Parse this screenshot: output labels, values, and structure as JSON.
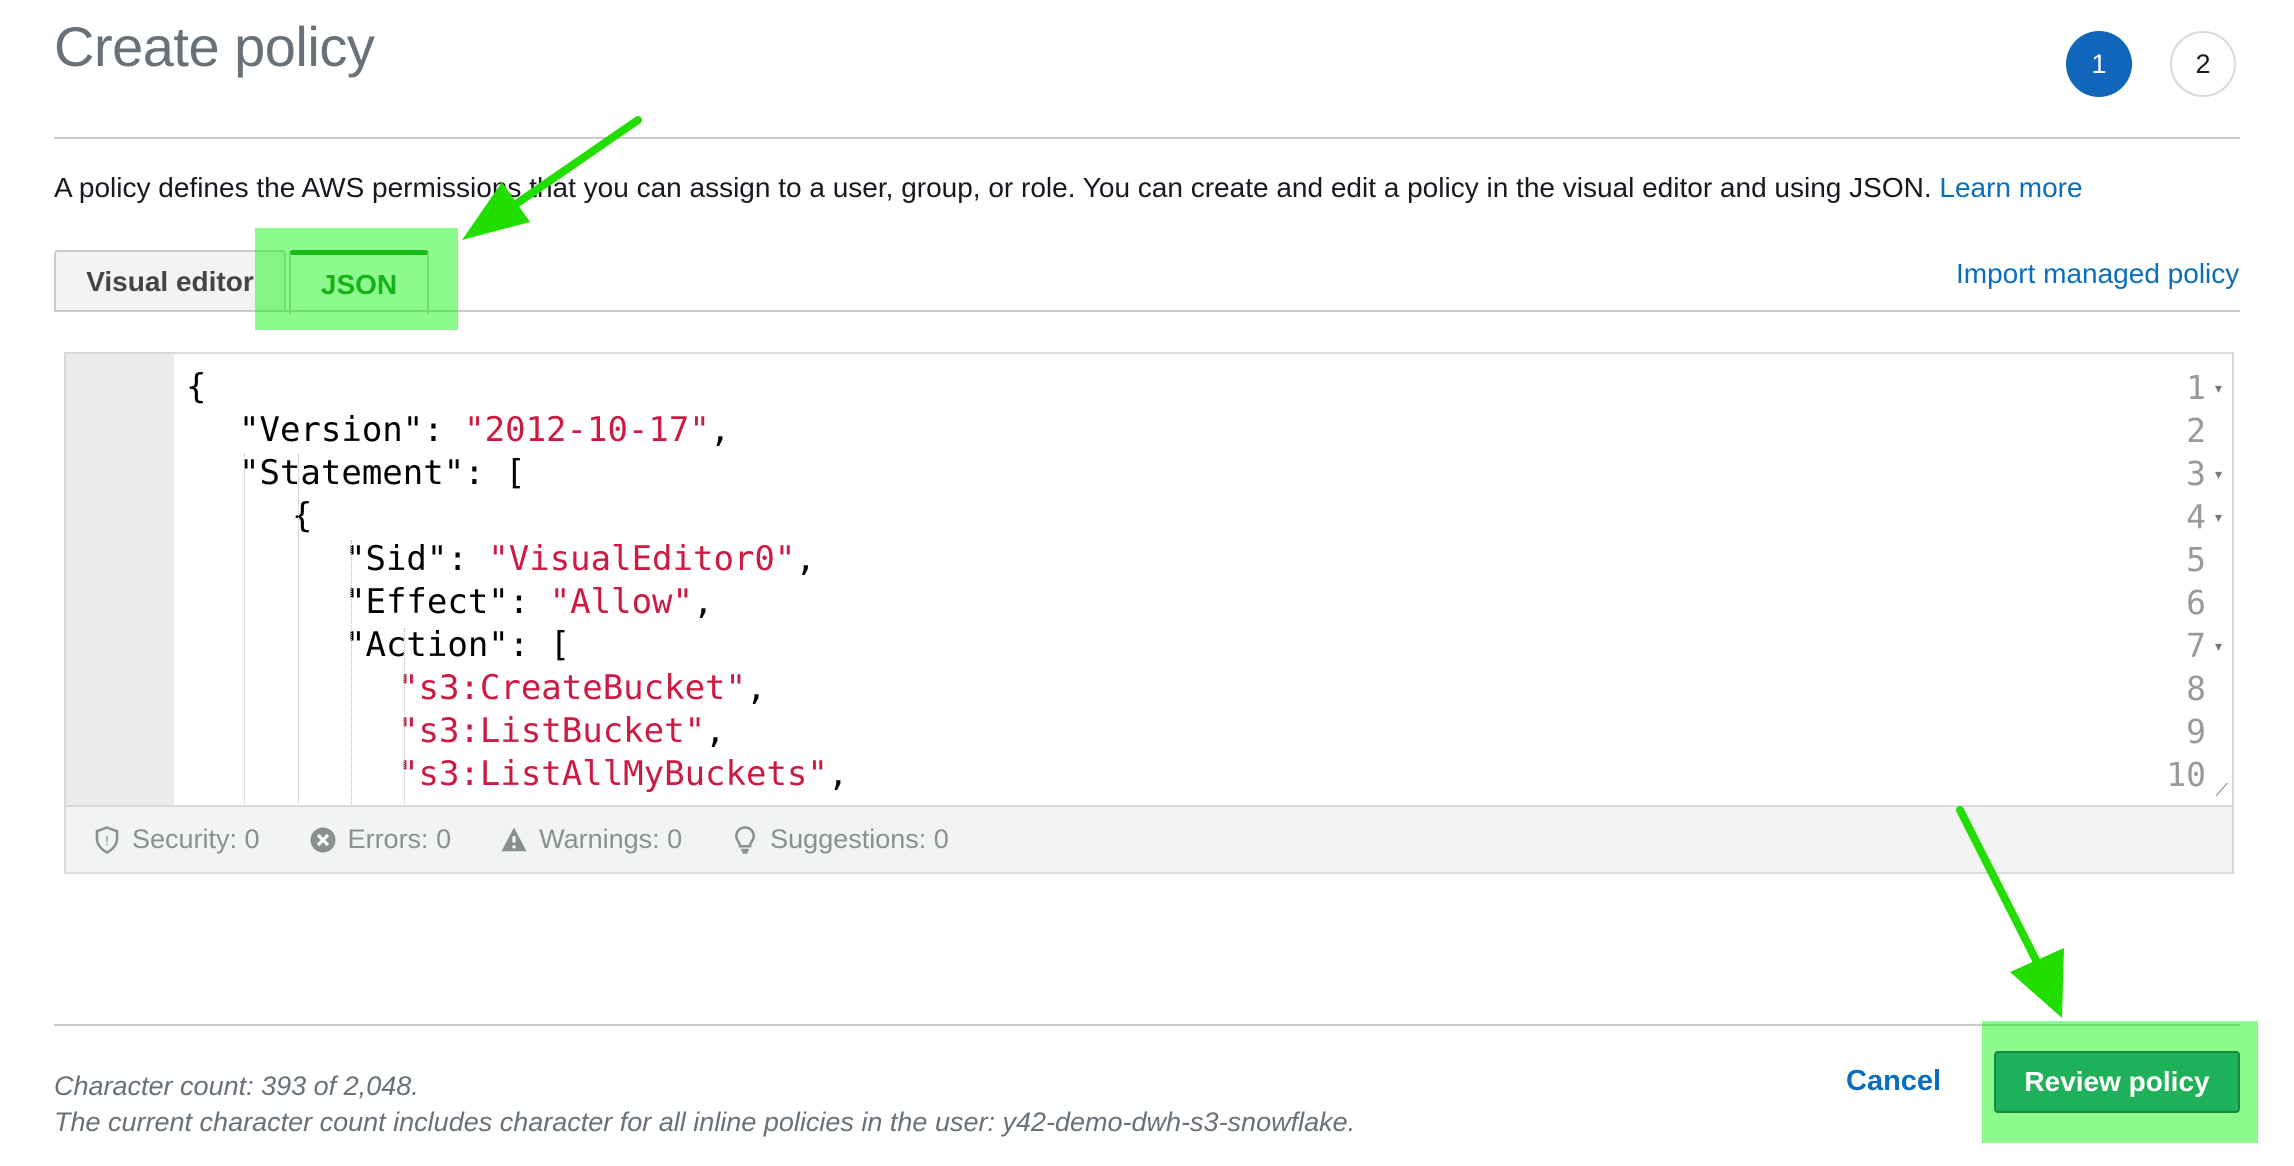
{
  "page": {
    "title": "Create policy",
    "steps": [
      "1",
      "2"
    ],
    "active_step": "1",
    "description": "A policy defines the AWS permissions that you can assign to a user, group, or role. You can create and edit a policy in the visual editor and using JSON.",
    "learn_more": "Learn more"
  },
  "tabs": {
    "visual_editor": "Visual editor",
    "json": "JSON",
    "active": "JSON",
    "import_link": "Import managed policy"
  },
  "editor": {
    "lines": [
      {
        "num": "1",
        "text": "{"
      },
      {
        "num": "2",
        "key": "\"Version\": ",
        "str": "\"2012-10-17\"",
        "tail": ","
      },
      {
        "num": "3",
        "text": "\"Statement\": ["
      },
      {
        "num": "4",
        "text": "{"
      },
      {
        "num": "5",
        "key": "\"Sid\": ",
        "str": "\"VisualEditor0\"",
        "tail": ","
      },
      {
        "num": "6",
        "key": "\"Effect\": ",
        "str": "\"Allow\"",
        "tail": ","
      },
      {
        "num": "7",
        "text": "\"Action\": ["
      },
      {
        "num": "8",
        "str": "\"s3:CreateBucket\"",
        "tail": ","
      },
      {
        "num": "9",
        "str": "\"s3:ListBucket\"",
        "tail": ","
      },
      {
        "num": "10",
        "str": "\"s3:ListAllMyBuckets\"",
        "tail": ","
      }
    ]
  },
  "status": {
    "security": "Security: 0",
    "errors": "Errors: 0",
    "warnings": "Warnings: 0",
    "suggestions": "Suggestions: 0"
  },
  "footer": {
    "char_count": "Character count: 393 of 2,048.",
    "note": "The current character count includes character for all inline policies in the user: y42-demo-dwh-s3-snowflake.",
    "cancel": "Cancel",
    "review": "Review policy"
  },
  "colors": {
    "accent": "#1166bb",
    "link": "#0a6ebd",
    "string": "#cc1a42",
    "primary_button": "#1fb05a",
    "annotation": "#22dd00"
  }
}
